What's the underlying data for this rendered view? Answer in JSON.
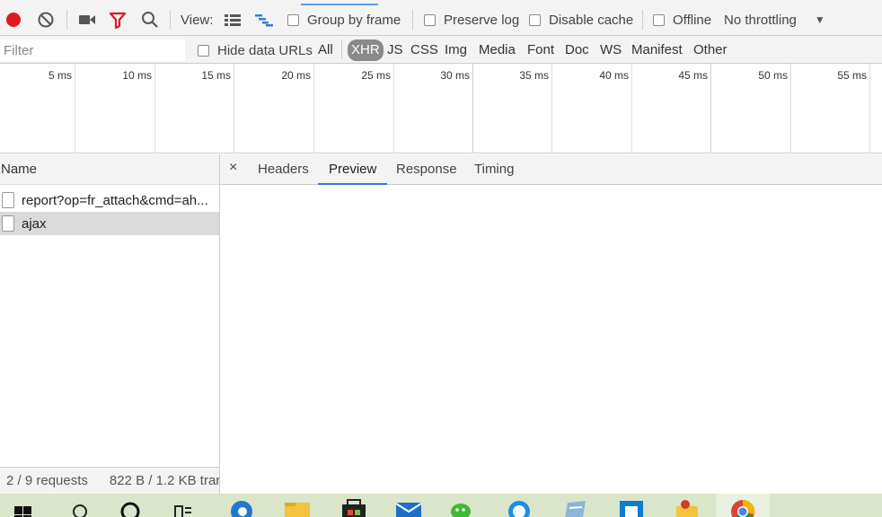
{
  "toolbar": {
    "view_label": "View:",
    "group_by_frame": "Group by frame",
    "preserve_log": "Preserve log",
    "disable_cache": "Disable cache",
    "offline": "Offline",
    "throttling": "No throttling",
    "record_color": "#e0191e"
  },
  "filterbar": {
    "filter_placeholder": "Filter",
    "hide_data_urls": "Hide data URLs",
    "types": [
      "All",
      "XHR",
      "JS",
      "CSS",
      "Img",
      "Media",
      "Font",
      "Doc",
      "WS",
      "Manifest",
      "Other"
    ],
    "active_type": "XHR"
  },
  "timeline": {
    "ticks": [
      "5 ms",
      "10 ms",
      "15 ms",
      "20 ms",
      "25 ms",
      "30 ms",
      "35 ms",
      "40 ms",
      "45 ms",
      "50 ms",
      "55 ms"
    ]
  },
  "requests": {
    "header": "Name",
    "rows": [
      "report?op=fr_attach&cmd=ah...",
      "ajax"
    ],
    "selected_row": "ajax",
    "status": {
      "count": "2 / 9 requests",
      "size": "822 B / 1.2 KB trar"
    }
  },
  "detail": {
    "tabs": [
      "Headers",
      "Preview",
      "Response",
      "Timing"
    ],
    "active_tab": "Preview",
    "close_symbol": "×"
  },
  "taskbar": {
    "background": "#d9e6c9",
    "icons": [
      "windows-start-icon",
      "search-icon",
      "cortana-icon",
      "task-view-icon",
      "edge-icon",
      "file-explorer-icon",
      "store-icon",
      "mail-icon",
      "wechat-icon",
      "qq-icon",
      "notepad-icon",
      "app-icon",
      "folder-app-icon",
      "chrome-icon"
    ]
  }
}
